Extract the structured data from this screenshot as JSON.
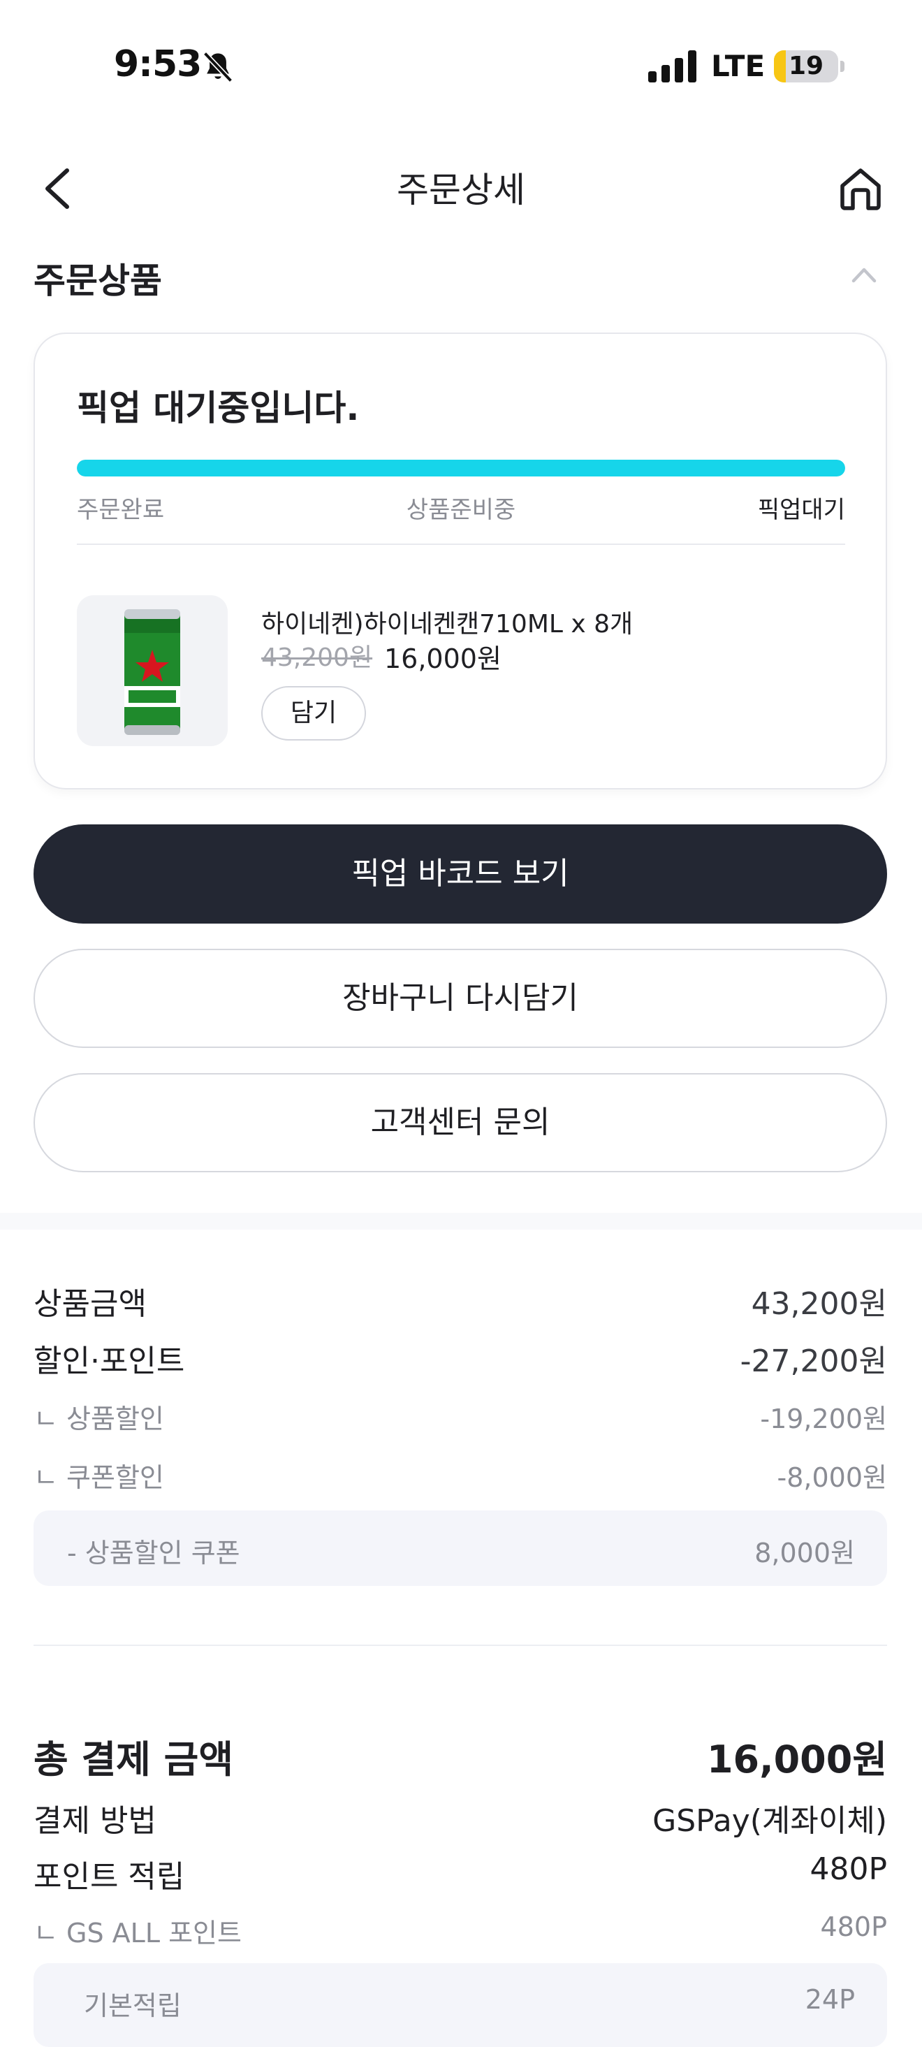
{
  "status_bar": {
    "time": "9:53",
    "network": "LTE",
    "battery": "19",
    "battery_level_percent": 19
  },
  "header": {
    "title": "주문상세"
  },
  "order_section": {
    "title": "주문상품",
    "status_text": "픽업 대기중입니다.",
    "progress_percent": 100,
    "steps": [
      "주문완료",
      "상품준비중",
      "픽업대기"
    ],
    "active_step": 2,
    "product": {
      "image_icon": "beer-can-icon",
      "name": "하이네켄)하이네켄캔710ML x 8개",
      "original_price": "43,200원",
      "sale_price": "16,000원",
      "add_label": "담기"
    }
  },
  "actions": {
    "barcode_label": "픽업 바코드 보기",
    "reorder_label": "장바구니 다시담기",
    "support_label": "고객센터 문의"
  },
  "summary": {
    "product_amount_label": "상품금액",
    "product_amount_value": "43,200원",
    "discount_label": "할인·포인트",
    "discount_value": "-27,200원",
    "product_discount_label": "ㄴ 상품할인",
    "product_discount_value": "-19,200원",
    "coupon_discount_label": "ㄴ 쿠폰할인",
    "coupon_discount_value": "-8,000원",
    "coupon_item_label": "- 상품할인 쿠폰",
    "coupon_item_value": "8,000원",
    "total_label": "총 결제 금액",
    "total_value": "16,000원",
    "payment_method_label": "결제 방법",
    "payment_method_value": "GSPay(계좌이체)",
    "points_label": "포인트 적립",
    "points_value": "480P",
    "gs_points_label": "ㄴ GS ALL 포인트",
    "gs_points_value": "480P",
    "basic_points_label": "기본적립",
    "basic_points_value": "24P"
  },
  "colors": {
    "progress": "#16d5ea",
    "primary_button": "#232733",
    "battery": "#f7c614"
  }
}
